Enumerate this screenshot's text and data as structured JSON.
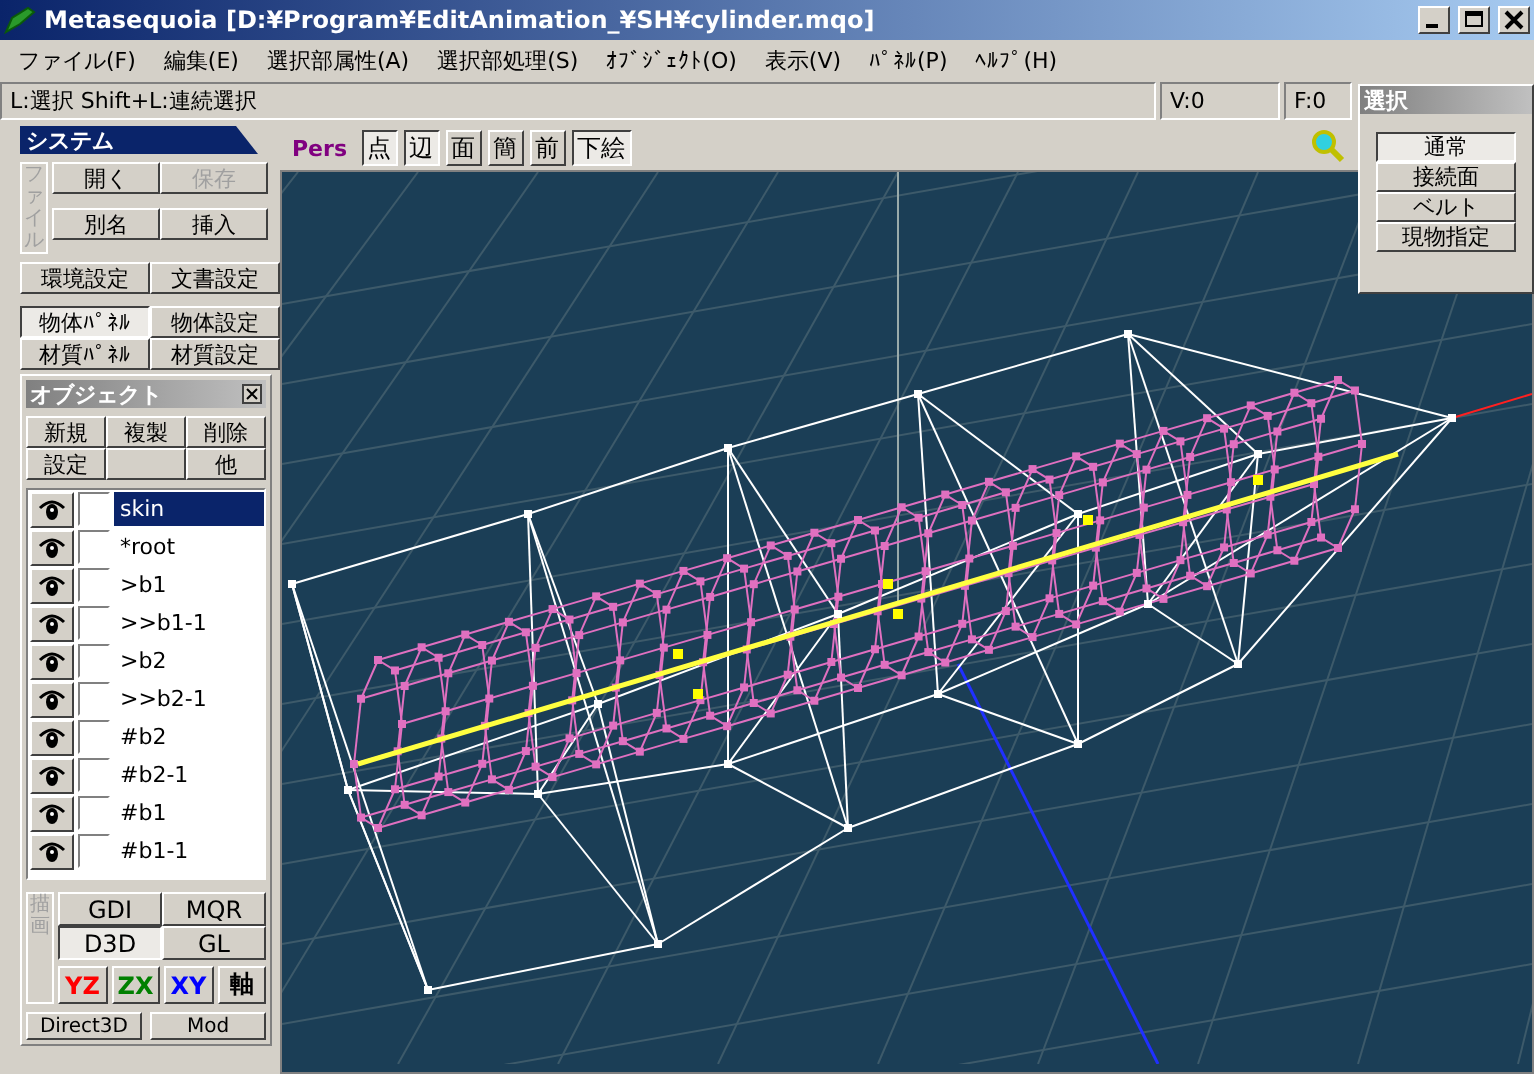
{
  "window": {
    "title": "Metasequoia [D:¥Program¥EditAnimation_¥SH¥cylinder.mqo]"
  },
  "menu": [
    "ファイル(F)",
    "編集(E)",
    "選択部属性(A)",
    "選択部処理(S)",
    "ｵﾌﾞｼﾞｪｸﾄ(O)",
    "表示(V)",
    "ﾊﾟﾈﾙ(P)",
    "ﾍﾙﾌﾟ(H)"
  ],
  "status_bar": {
    "hint": "L:選択  Shift+L:連続選択",
    "vertices": "V:0",
    "faces": "F:0"
  },
  "system_panel": {
    "title": "システム",
    "file_label": "ファイル",
    "file_buttons": [
      {
        "label": "開く",
        "disabled": false
      },
      {
        "label": "保存",
        "disabled": true
      },
      {
        "label": "別名",
        "disabled": false
      },
      {
        "label": "挿入",
        "disabled": false
      }
    ],
    "setting_buttons": [
      {
        "label": "環境設定",
        "selected": false
      },
      {
        "label": "文書設定",
        "selected": false
      },
      {
        "label": "物体ﾊﾟﾈﾙ",
        "selected": true
      },
      {
        "label": "物体設定",
        "selected": false
      },
      {
        "label": "材質ﾊﾟﾈﾙ",
        "selected": false
      },
      {
        "label": "材質設定",
        "selected": false
      }
    ]
  },
  "object_panel": {
    "title": "オブジェクト",
    "buttons": [
      {
        "kind": "text",
        "label": "新規"
      },
      {
        "kind": "text",
        "label": "複製"
      },
      {
        "kind": "text",
        "label": "削除"
      },
      {
        "kind": "text",
        "label": "設定"
      },
      {
        "kind": "blank"
      },
      {
        "kind": "text",
        "label": "他"
      }
    ],
    "objects": [
      {
        "name": "skin",
        "selected": true,
        "visible": true,
        "locked": false
      },
      {
        "name": "*root",
        "selected": false,
        "visible": true,
        "locked": false
      },
      {
        "name": ">b1",
        "selected": false,
        "visible": true,
        "locked": false
      },
      {
        "name": ">>b1-1",
        "selected": false,
        "visible": true,
        "locked": false
      },
      {
        "name": ">b2",
        "selected": false,
        "visible": true,
        "locked": false
      },
      {
        "name": ">>b2-1",
        "selected": false,
        "visible": true,
        "locked": false
      },
      {
        "name": "#b2",
        "selected": false,
        "visible": true,
        "locked": false
      },
      {
        "name": "#b2-1",
        "selected": false,
        "visible": true,
        "locked": false
      },
      {
        "name": "#b1",
        "selected": false,
        "visible": true,
        "locked": false
      },
      {
        "name": "#b1-1",
        "selected": false,
        "visible": true,
        "locked": false
      }
    ]
  },
  "render_panel": {
    "label": "描画",
    "modes": [
      {
        "label": "GDI",
        "selected": false
      },
      {
        "label": "MQR",
        "selected": false
      },
      {
        "label": "D3D",
        "selected": true
      },
      {
        "label": "GL",
        "selected": false
      }
    ],
    "views": [
      {
        "label": "YZ",
        "color": "#ff0000"
      },
      {
        "label": "ZX",
        "color": "#008000"
      },
      {
        "label": "XY",
        "color": "#0000ff"
      },
      {
        "label": "軸",
        "color": "#000000"
      }
    ],
    "footer": [
      "Direct3D",
      "Mod"
    ]
  },
  "viewport": {
    "projection": "Pers",
    "toggles": [
      {
        "label": "点",
        "on": true
      },
      {
        "label": "辺",
        "on": true
      },
      {
        "label": "面",
        "on": false
      },
      {
        "label": "簡",
        "on": false
      },
      {
        "label": "前",
        "on": false
      },
      {
        "label": "下絵",
        "on": true
      }
    ]
  },
  "select_panel": {
    "title": "選択",
    "modes": [
      {
        "label": "通常",
        "selected": true
      },
      {
        "label": "接続面",
        "selected": false
      },
      {
        "label": "ベルト",
        "selected": false
      },
      {
        "label": "現物指定",
        "selected": false
      }
    ]
  }
}
